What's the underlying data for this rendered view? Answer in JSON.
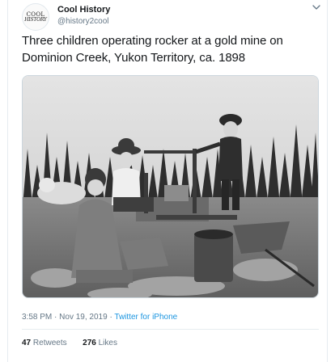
{
  "user": {
    "display_name": "Cool History",
    "handle": "@history2cool",
    "avatar_line1": "COOL",
    "avatar_line2": "HISTORY"
  },
  "tweet": {
    "text": "Three children operating rocker at a gold mine on Dominion Creek, Yukon Territory, ca. 1898",
    "time": "3:58 PM",
    "separator": "·",
    "date": "Nov 19, 2019",
    "source": "Twitter for iPhone"
  },
  "stats": {
    "retweets_count": "47",
    "retweets_label": "Retweets",
    "likes_count": "276",
    "likes_label": "Likes"
  },
  "icons": {
    "menu": "chevron-down-icon"
  },
  "colors": {
    "link": "#1b95e0",
    "secondary_text": "#657786",
    "border": "#e6ecf0"
  }
}
